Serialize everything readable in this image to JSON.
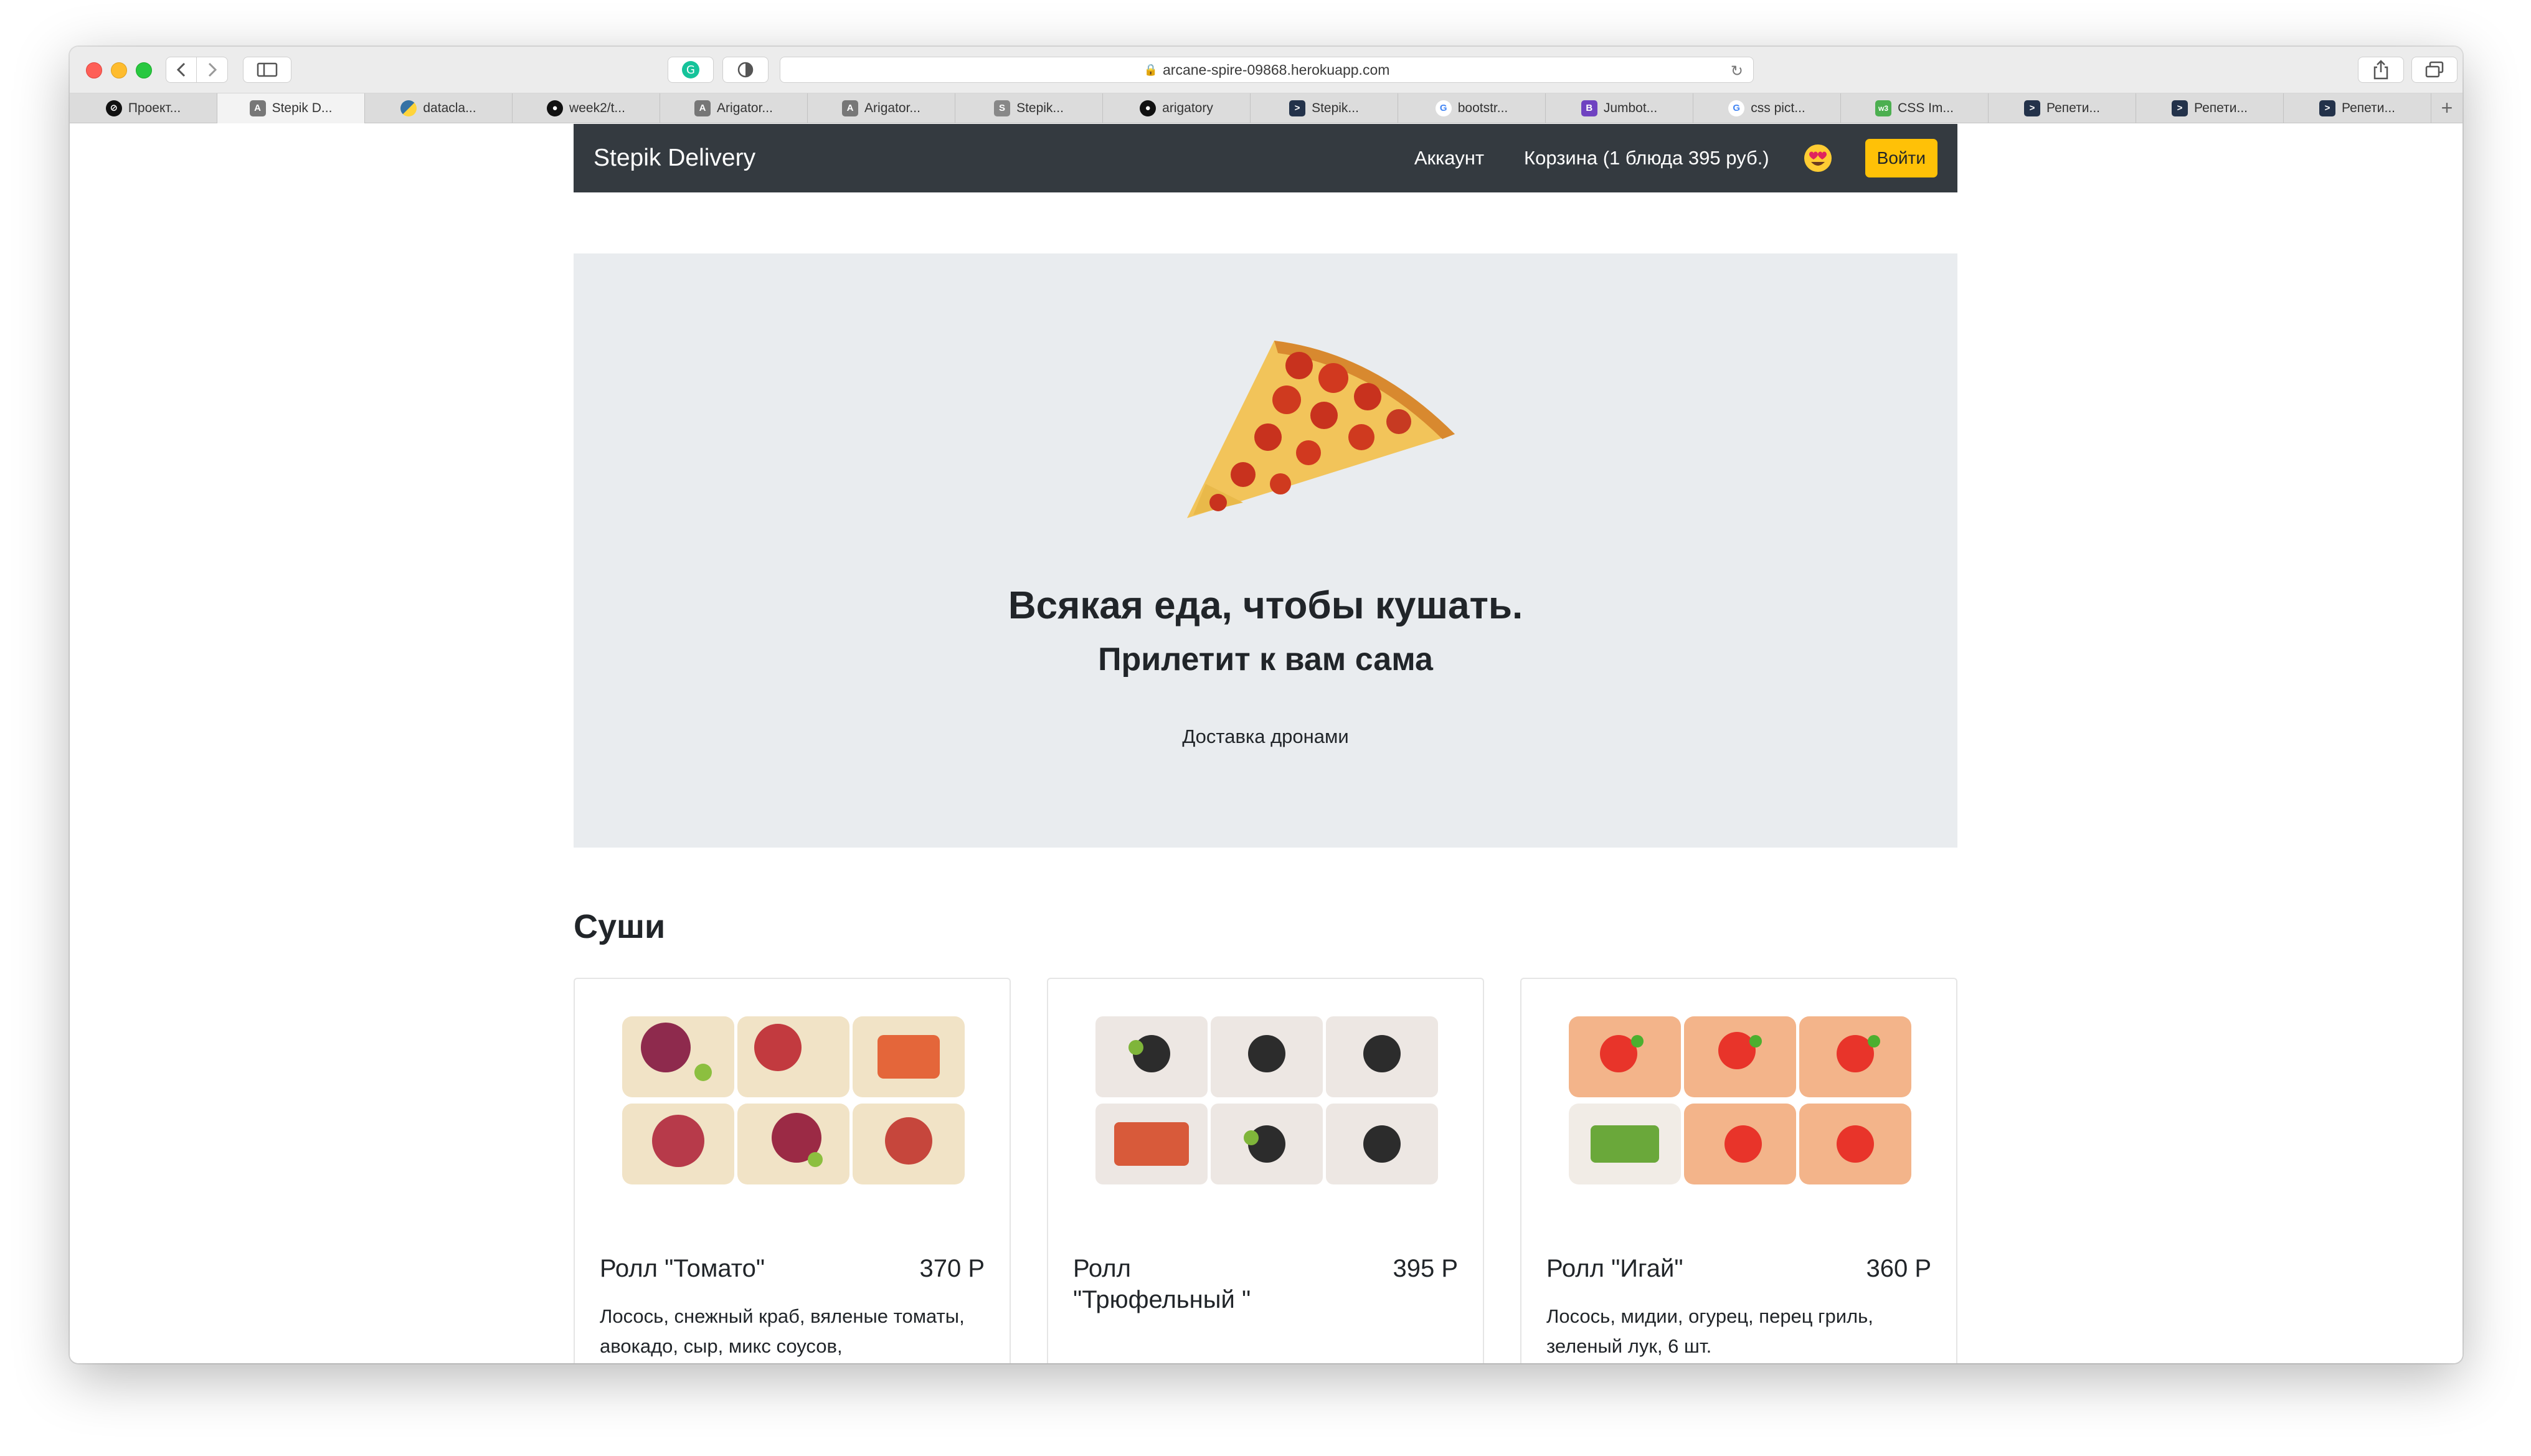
{
  "browser": {
    "url": "arcane-spire-09868.herokuapp.com",
    "tabs": [
      {
        "label": "Проект...",
        "icon": "circle-slash-icon"
      },
      {
        "label": "Stepik D...",
        "icon": "letter-a-icon",
        "active": true
      },
      {
        "label": "datacla...",
        "icon": "python-icon"
      },
      {
        "label": "week2/t...",
        "icon": "github-icon"
      },
      {
        "label": "Arigator...",
        "icon": "letter-a-icon"
      },
      {
        "label": "Arigator...",
        "icon": "letter-a-icon"
      },
      {
        "label": "Stepik...",
        "icon": "letter-s-icon"
      },
      {
        "label": "arigatory",
        "icon": "github-icon"
      },
      {
        "label": "Stepik...",
        "icon": "terminal-icon"
      },
      {
        "label": "bootstr...",
        "icon": "google-icon"
      },
      {
        "label": "Jumbot...",
        "icon": "bootstrap-icon"
      },
      {
        "label": "css pict...",
        "icon": "google-icon"
      },
      {
        "label": "CSS Im...",
        "icon": "w3-icon"
      },
      {
        "label": "Репети...",
        "icon": "terminal-icon"
      },
      {
        "label": "Репети...",
        "icon": "terminal-icon"
      },
      {
        "label": "Репети...",
        "icon": "terminal-icon"
      }
    ]
  },
  "navbar": {
    "brand": "Stepik Delivery",
    "account": "Аккаунт",
    "cart": "Корзина (1 блюда 395 руб.)",
    "login": "Войти"
  },
  "hero": {
    "title": "Всякая еда, чтобы кушать.",
    "subtitle": "Прилетит к вам сама",
    "text": "Доставка дронами"
  },
  "section": {
    "title": "Суши",
    "cards": [
      {
        "title": "Ролл \"Томато\"",
        "price": "370 Р",
        "desc": "Лосось, снежный краб, вяленые томаты, авокадо, сыр, микс соусов,"
      },
      {
        "title": "Ролл \"Трюфельный \"",
        "price": "395 Р",
        "desc": ""
      },
      {
        "title": "Ролл \"Игай\"",
        "price": "360 Р",
        "desc": "Лосось, мидии, огурец, перец гриль, зеленый лук, 6 шт."
      }
    ]
  },
  "colors": {
    "navbar": "#343a40",
    "jumbotron": "#e9ecef",
    "login_button": "#ffc107"
  }
}
